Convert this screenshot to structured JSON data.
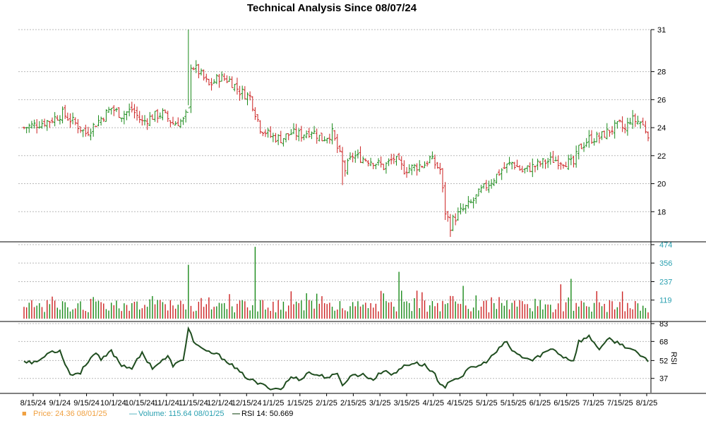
{
  "chart_data": {
    "type": "ohlc",
    "title": "Technical Analysis Since 08/07/24",
    "colors": {
      "up": "#1a8a1a",
      "down": "#cc2222",
      "rsi": "#1f4d1f",
      "volume_label": "#2aa0b0",
      "price_legend": "#f0a040",
      "grid": "#b8b8b8"
    },
    "x_ticks": [
      "8/15/24",
      "9/1/24",
      "9/15/24",
      "10/1/24",
      "10/15/24",
      "11/1/24",
      "11/15/24",
      "12/1/24",
      "12/15/24",
      "1/1/25",
      "1/15/25",
      "2/1/25",
      "2/15/25",
      "3/1/25",
      "3/15/25",
      "4/1/25",
      "4/15/25",
      "5/1/25",
      "5/15/25",
      "6/1/25",
      "6/15/25",
      "7/1/25",
      "7/15/25",
      "8/1/25"
    ],
    "price_panel": {
      "y_ticks": [
        18,
        20,
        22,
        24,
        26,
        28,
        31
      ],
      "ylim": [
        16,
        31
      ],
      "anchors": [
        [
          0,
          24.0
        ],
        [
          10,
          24.5
        ],
        [
          15,
          25.0
        ],
        [
          20,
          24.3
        ],
        [
          24,
          23.6
        ],
        [
          28,
          24.3
        ],
        [
          34,
          25.4
        ],
        [
          38,
          24.9
        ],
        [
          42,
          25.3
        ],
        [
          46,
          24.4
        ],
        [
          50,
          24.8
        ],
        [
          54,
          25.0
        ],
        [
          58,
          24.3
        ],
        [
          62,
          24.5
        ],
        [
          64,
          25.2
        ],
        [
          65,
          28.5
        ],
        [
          68,
          28.0
        ],
        [
          72,
          27.0
        ],
        [
          76,
          27.6
        ],
        [
          80,
          27.4
        ],
        [
          84,
          26.6
        ],
        [
          88,
          26.2
        ],
        [
          92,
          24.0
        ],
        [
          96,
          23.4
        ],
        [
          100,
          23.2
        ],
        [
          104,
          23.6
        ],
        [
          108,
          23.5
        ],
        [
          112,
          23.8
        ],
        [
          116,
          23.2
        ],
        [
          120,
          23.6
        ],
        [
          123,
          22.0
        ],
        [
          125,
          21.0
        ],
        [
          128,
          22.0
        ],
        [
          132,
          21.8
        ],
        [
          136,
          21.6
        ],
        [
          140,
          21.2
        ],
        [
          144,
          21.8
        ],
        [
          148,
          21.0
        ],
        [
          152,
          21.2
        ],
        [
          156,
          21.4
        ],
        [
          158,
          21.8
        ],
        [
          162,
          21.0
        ],
        [
          164,
          18.0
        ],
        [
          166,
          17.0
        ],
        [
          167,
          17.4
        ],
        [
          170,
          18.0
        ],
        [
          174,
          18.6
        ],
        [
          178,
          19.5
        ],
        [
          182,
          20.2
        ],
        [
          186,
          21.0
        ],
        [
          190,
          21.5
        ],
        [
          194,
          20.9
        ],
        [
          198,
          21.2
        ],
        [
          202,
          21.5
        ],
        [
          206,
          21.7
        ],
        [
          210,
          21.6
        ],
        [
          214,
          21.4
        ],
        [
          216,
          22.5
        ],
        [
          220,
          23.2
        ],
        [
          224,
          23.3
        ],
        [
          228,
          23.8
        ],
        [
          232,
          24.2
        ],
        [
          234,
          23.8
        ],
        [
          236,
          24.6
        ],
        [
          240,
          24.4
        ],
        [
          243,
          23.6
        ]
      ]
    },
    "volume_panel": {
      "y_ticks": [
        119,
        237,
        356,
        474
      ],
      "ylim": [
        0,
        474
      ],
      "spikes": [
        [
          64,
          345
        ],
        [
          90,
          460
        ],
        [
          146,
          300
        ],
        [
          213,
          255
        ],
        [
          209,
          220
        ],
        [
          171,
          210
        ]
      ]
    },
    "rsi_panel": {
      "label": "RSI",
      "y_ticks": [
        37,
        52,
        68,
        83
      ],
      "ylim": [
        25,
        83
      ],
      "anchors": [
        [
          0,
          52
        ],
        [
          4,
          50
        ],
        [
          8,
          55
        ],
        [
          10,
          60
        ],
        [
          14,
          60
        ],
        [
          18,
          40
        ],
        [
          22,
          42
        ],
        [
          26,
          55
        ],
        [
          28,
          58
        ],
        [
          30,
          52
        ],
        [
          34,
          60
        ],
        [
          38,
          48
        ],
        [
          42,
          46
        ],
        [
          46,
          58
        ],
        [
          50,
          46
        ],
        [
          54,
          52
        ],
        [
          56,
          55
        ],
        [
          58,
          48
        ],
        [
          62,
          52
        ],
        [
          64,
          80
        ],
        [
          66,
          68
        ],
        [
          70,
          60
        ],
        [
          74,
          58
        ],
        [
          76,
          56
        ],
        [
          80,
          50
        ],
        [
          84,
          42
        ],
        [
          88,
          36
        ],
        [
          92,
          32
        ],
        [
          96,
          29
        ],
        [
          100,
          28
        ],
        [
          104,
          38
        ],
        [
          108,
          36
        ],
        [
          110,
          42
        ],
        [
          114,
          40
        ],
        [
          118,
          38
        ],
        [
          122,
          40
        ],
        [
          124,
          32
        ],
        [
          128,
          40
        ],
        [
          132,
          40
        ],
        [
          136,
          36
        ],
        [
          140,
          44
        ],
        [
          144,
          40
        ],
        [
          148,
          48
        ],
        [
          152,
          50
        ],
        [
          156,
          48
        ],
        [
          158,
          44
        ],
        [
          160,
          41
        ],
        [
          162,
          32
        ],
        [
          164,
          28
        ],
        [
          166,
          36
        ],
        [
          170,
          38
        ],
        [
          174,
          46
        ],
        [
          178,
          48
        ],
        [
          182,
          55
        ],
        [
          186,
          64
        ],
        [
          188,
          68
        ],
        [
          190,
          60
        ],
        [
          194,
          55
        ],
        [
          198,
          52
        ],
        [
          202,
          58
        ],
        [
          206,
          62
        ],
        [
          210,
          55
        ],
        [
          214,
          52
        ],
        [
          216,
          68
        ],
        [
          220,
          72
        ],
        [
          224,
          62
        ],
        [
          228,
          70
        ],
        [
          232,
          66
        ],
        [
          236,
          62
        ],
        [
          240,
          56
        ],
        [
          243,
          51
        ]
      ]
    },
    "count": 244,
    "legend": [
      {
        "marker": "■",
        "label": "Price: 24.36  08/01/25"
      },
      {
        "marker": "—",
        "label": "Volume: 115.64  08/01/25"
      },
      {
        "marker": "—",
        "label": "RSI 14: 50.669"
      }
    ]
  }
}
